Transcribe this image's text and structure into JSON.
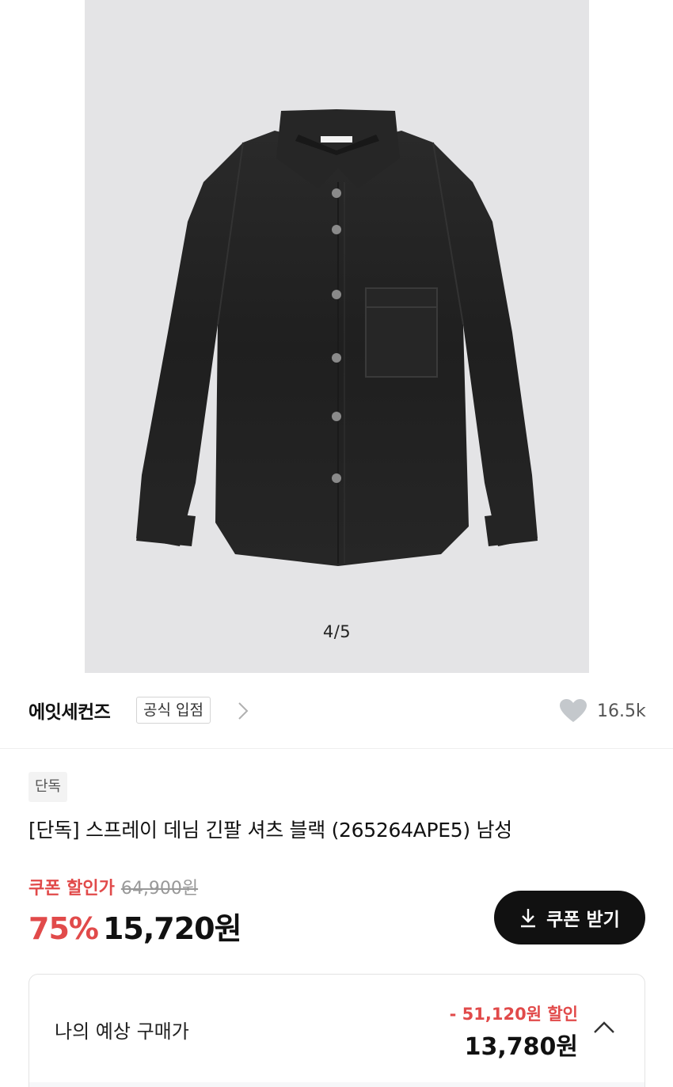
{
  "gallery": {
    "pager": "4/5",
    "image_alt": "black denim long-sleeve shirt"
  },
  "brand": {
    "name": "에잇세컨즈",
    "official_badge": "공식 입점",
    "likes": "16.5k"
  },
  "product": {
    "tag": "단독",
    "title": "[단독] 스프레이 데님 긴팔 셔츠 블랙 (265264APE5) 남성",
    "coupon_label": "쿠폰 할인가",
    "original_price": "64,900원",
    "discount_rate": "75%",
    "final_price": "15,720원",
    "coupon_button": "쿠폰 받기"
  },
  "estimate": {
    "label": "나의 예상 구매가",
    "discount": "- 51,120원 할인",
    "price": "13,780원"
  },
  "colors": {
    "accent_red": "#e14a4a",
    "button_black": "#111111",
    "image_bg": "#e4e4e6"
  },
  "icons": [
    "chevron-right-icon",
    "heart-icon",
    "download-icon",
    "chevron-up-icon"
  ]
}
